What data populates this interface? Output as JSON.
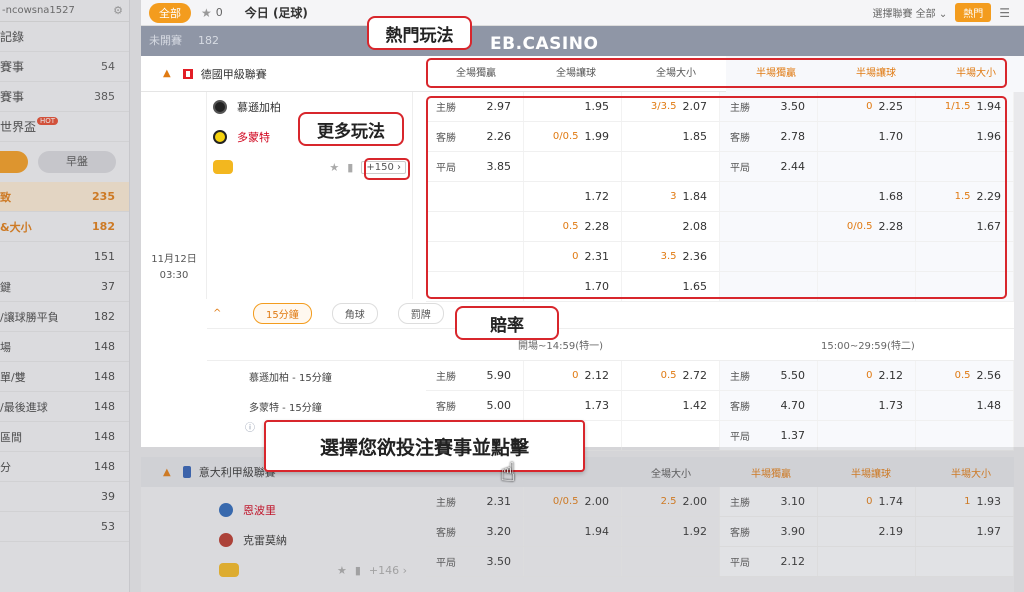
{
  "sidebar": {
    "username": "-ncowsna1527",
    "rows": [
      {
        "label": "記錄",
        "count": ""
      },
      {
        "label": "賽事",
        "count": "54"
      },
      {
        "label": "賽事",
        "count": "385"
      },
      {
        "label": "世界盃",
        "count": "",
        "badge": "HOT"
      }
    ],
    "toggle_right": "早盤",
    "subs": [
      {
        "label": "致",
        "count": "235",
        "state": "active"
      },
      {
        "label": "&大小",
        "count": "182",
        "state": "orange"
      },
      {
        "label": "",
        "count": "151"
      },
      {
        "label": "鍵",
        "count": "37"
      },
      {
        "label": "/讓球勝平負",
        "count": "182"
      },
      {
        "label": "場",
        "count": "148"
      },
      {
        "label": "單/雙",
        "count": "148"
      },
      {
        "label": "/最後進球",
        "count": "148"
      },
      {
        "label": "區間",
        "count": "148"
      },
      {
        "label": "分",
        "count": "148"
      },
      {
        "label": "",
        "count": "39"
      },
      {
        "label": "",
        "count": "53"
      }
    ]
  },
  "topbar": {
    "all_label": "全部",
    "fav_count": "0",
    "today_label": "今日 (足球)",
    "league_select": "選擇聯賽 全部",
    "hot_button": "熱門"
  },
  "notstarted": {
    "label": "未開賽",
    "count": "182"
  },
  "brand": "EB.CASINO",
  "league1": {
    "name": "德國甲級聯賽",
    "columns": [
      "全場獨贏",
      "全場讓球",
      "全場大小",
      "半場獨贏",
      "半場讓球",
      "半場大小"
    ],
    "date": "11月12日",
    "time": "03:30",
    "home": "慕遜加柏",
    "away": "多蒙特",
    "more": "+150",
    "rows": [
      [
        {
          "lbl": "主勝",
          "v": "2.97"
        },
        {
          "hc": "",
          "v": "1.95"
        },
        {
          "hc": "3/3.5",
          "v": "2.07"
        },
        {
          "lbl": "主勝",
          "v": "3.50"
        },
        {
          "hc": "0",
          "v": "2.25"
        },
        {
          "hc": "1/1.5",
          "v": "1.94"
        }
      ],
      [
        {
          "lbl": "客勝",
          "v": "2.26"
        },
        {
          "hc": "0/0.5",
          "v": "1.99"
        },
        {
          "hc": "",
          "v": "1.85"
        },
        {
          "lbl": "客勝",
          "v": "2.78"
        },
        {
          "hc": "",
          "v": "1.70"
        },
        {
          "hc": "",
          "v": "1.96"
        }
      ],
      [
        {
          "lbl": "平局",
          "v": "3.85"
        },
        {
          "hc": "",
          "v": ""
        },
        {
          "hc": "",
          "v": ""
        },
        {
          "lbl": "平局",
          "v": "2.44"
        },
        {
          "hc": "",
          "v": ""
        },
        {
          "hc": "",
          "v": ""
        }
      ],
      [
        {
          "lbl": "",
          "v": ""
        },
        {
          "hc": "",
          "v": "1.72"
        },
        {
          "hc": "3",
          "v": "1.84"
        },
        {
          "lbl": "",
          "v": ""
        },
        {
          "hc": "",
          "v": "1.68"
        },
        {
          "hc": "1.5",
          "v": "2.29"
        }
      ],
      [
        {
          "lbl": "",
          "v": ""
        },
        {
          "hc": "0.5",
          "v": "2.28"
        },
        {
          "hc": "",
          "v": "2.08"
        },
        {
          "lbl": "",
          "v": ""
        },
        {
          "hc": "0/0.5",
          "v": "2.28"
        },
        {
          "hc": "",
          "v": "1.67"
        }
      ],
      [
        {
          "lbl": "",
          "v": ""
        },
        {
          "hc": "0",
          "v": "2.31"
        },
        {
          "hc": "3.5",
          "v": "2.36"
        },
        {
          "lbl": "",
          "v": ""
        },
        {
          "hc": "",
          "v": ""
        },
        {
          "hc": "",
          "v": ""
        }
      ],
      [
        {
          "lbl": "",
          "v": ""
        },
        {
          "hc": "",
          "v": "1.70"
        },
        {
          "hc": "",
          "v": "1.65"
        },
        {
          "lbl": "",
          "v": ""
        },
        {
          "hc": "",
          "v": ""
        },
        {
          "hc": "",
          "v": ""
        }
      ]
    ],
    "sub_tabs": [
      "15分鐘",
      "角球",
      "罰牌"
    ],
    "period1": "開場~14:59(特一)",
    "period2": "15:00~29:59(特二)",
    "sub_home": "慕遜加柏 - 15分鐘",
    "sub_away": "多蒙特 - 15分鐘",
    "sub_rows": [
      [
        {
          "lbl": "主勝",
          "v": "5.90"
        },
        {
          "hc": "0",
          "v": "2.12"
        },
        {
          "hc": "0.5",
          "v": "2.72"
        },
        {
          "lbl": "主勝",
          "v": "5.50"
        },
        {
          "hc": "0",
          "v": "2.12"
        },
        {
          "hc": "0.5",
          "v": "2.56"
        }
      ],
      [
        {
          "lbl": "客勝",
          "v": "5.00"
        },
        {
          "hc": "",
          "v": "1.73"
        },
        {
          "hc": "",
          "v": "1.42"
        },
        {
          "lbl": "客勝",
          "v": "4.70"
        },
        {
          "hc": "",
          "v": "1.73"
        },
        {
          "hc": "",
          "v": "1.48"
        }
      ],
      [
        {
          "lbl": "",
          "v": ""
        },
        {
          "hc": "",
          "v": ""
        },
        {
          "hc": "",
          "v": ""
        },
        {
          "lbl": "平局",
          "v": "1.37"
        },
        {
          "hc": "",
          "v": ""
        },
        {
          "hc": "",
          "v": ""
        }
      ]
    ]
  },
  "league2": {
    "name": "意大利甲級聯賽",
    "columns": [
      "全場大小",
      "半場獨贏",
      "半場讓球",
      "半場大小"
    ],
    "home": "恩波里",
    "away": "克雷莫納",
    "more": "+146",
    "rows": [
      [
        {
          "lbl": "主勝",
          "v": "2.31"
        },
        {
          "hc": "0/0.5",
          "v": "2.00"
        },
        {
          "hc": "2.5",
          "v": "2.00"
        },
        {
          "lbl": "主勝",
          "v": "3.10"
        },
        {
          "hc": "0",
          "v": "1.74"
        },
        {
          "hc": "1",
          "v": "1.93"
        }
      ],
      [
        {
          "lbl": "客勝",
          "v": "3.20"
        },
        {
          "hc": "",
          "v": "1.94"
        },
        {
          "hc": "",
          "v": "1.92"
        },
        {
          "lbl": "客勝",
          "v": "3.90"
        },
        {
          "hc": "",
          "v": "2.19"
        },
        {
          "hc": "",
          "v": "1.97"
        }
      ],
      [
        {
          "lbl": "平局",
          "v": "3.50"
        },
        {
          "hc": "",
          "v": ""
        },
        {
          "hc": "",
          "v": ""
        },
        {
          "lbl": "平局",
          "v": "2.12"
        },
        {
          "hc": "",
          "v": ""
        },
        {
          "hc": "",
          "v": ""
        }
      ]
    ]
  },
  "callouts": {
    "hot_play": "熱門玩法",
    "more_play": "更多玩法",
    "odds": "賠率",
    "instruction": "選擇您欲投注賽事並點擊"
  },
  "colors": {
    "accent": "#f39c1e",
    "annotation": "#d8262c",
    "handicap": "#e07a12"
  }
}
